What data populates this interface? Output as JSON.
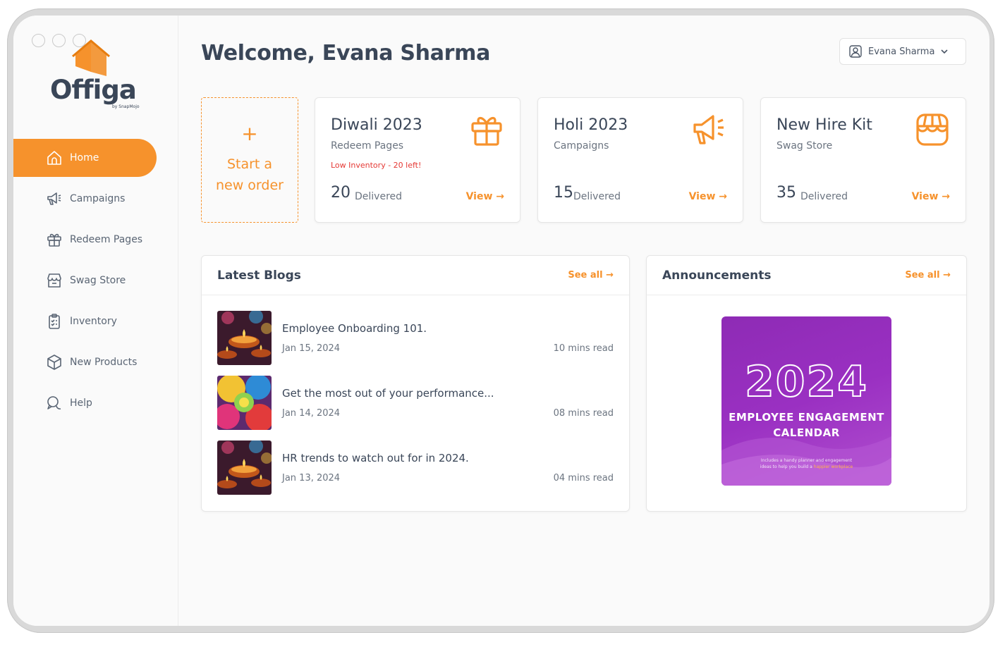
{
  "colors": {
    "accent": "#f6922c",
    "text": "#3a4658",
    "warning": "#e53935",
    "poster_bg": "#9a30c2"
  },
  "brand": {
    "name": "Offiga",
    "byline": "by SnapMojo"
  },
  "sidebar": {
    "items": [
      {
        "label": "Home",
        "icon": "home-icon",
        "active": true
      },
      {
        "label": "Campaigns",
        "icon": "megaphone-icon"
      },
      {
        "label": "Redeem Pages",
        "icon": "gift-icon"
      },
      {
        "label": "Swag Store",
        "icon": "store-icon"
      },
      {
        "label": "Inventory",
        "icon": "clipboard-icon"
      },
      {
        "label": "New Products",
        "icon": "box-icon"
      },
      {
        "label": "Help",
        "icon": "chat-icon"
      }
    ]
  },
  "header": {
    "welcome": "Welcome, Evana Sharma",
    "user_name": "Evana Sharma"
  },
  "start_order": {
    "plus": "+",
    "line1": "Start a",
    "line2": "new order"
  },
  "cards": [
    {
      "title": "Diwali 2023",
      "subtitle": "Redeem Pages",
      "warning": "Low Inventory - 20 left!",
      "count": "20",
      "count_label": "Delivered",
      "view": "View →",
      "icon": "gift-icon"
    },
    {
      "title": "Holi 2023",
      "subtitle": "Campaigns",
      "warning": "",
      "count": "15",
      "count_label": "Delivered",
      "view": "View →",
      "icon": "megaphone-icon"
    },
    {
      "title": "New Hire Kit",
      "subtitle": "Swag Store",
      "warning": "",
      "count": "35",
      "count_label": "Delivered",
      "view": "View →",
      "icon": "store-icon"
    }
  ],
  "blogs": {
    "title": "Latest Blogs",
    "see_all": "See all →",
    "items": [
      {
        "title": "Employee Onboarding 101.",
        "date": "Jan 15, 2024",
        "read": "10 mins read"
      },
      {
        "title": "Get the most out of your performance...",
        "date": "Jan 14, 2024",
        "read": "08 mins read"
      },
      {
        "title": "HR trends to watch out for in 2024.",
        "date": "Jan 13, 2024",
        "read": "04 mins read"
      }
    ]
  },
  "announcements": {
    "title": "Announcements",
    "see_all": "See all →",
    "poster": {
      "year": "2024",
      "line1": "EMPLOYEE ENGAGEMENT",
      "line2": "CALENDAR",
      "note1": "Includes a handy planner and engagement",
      "note2": "ideas to help you build a",
      "note_highlight": "happier workplace"
    }
  }
}
